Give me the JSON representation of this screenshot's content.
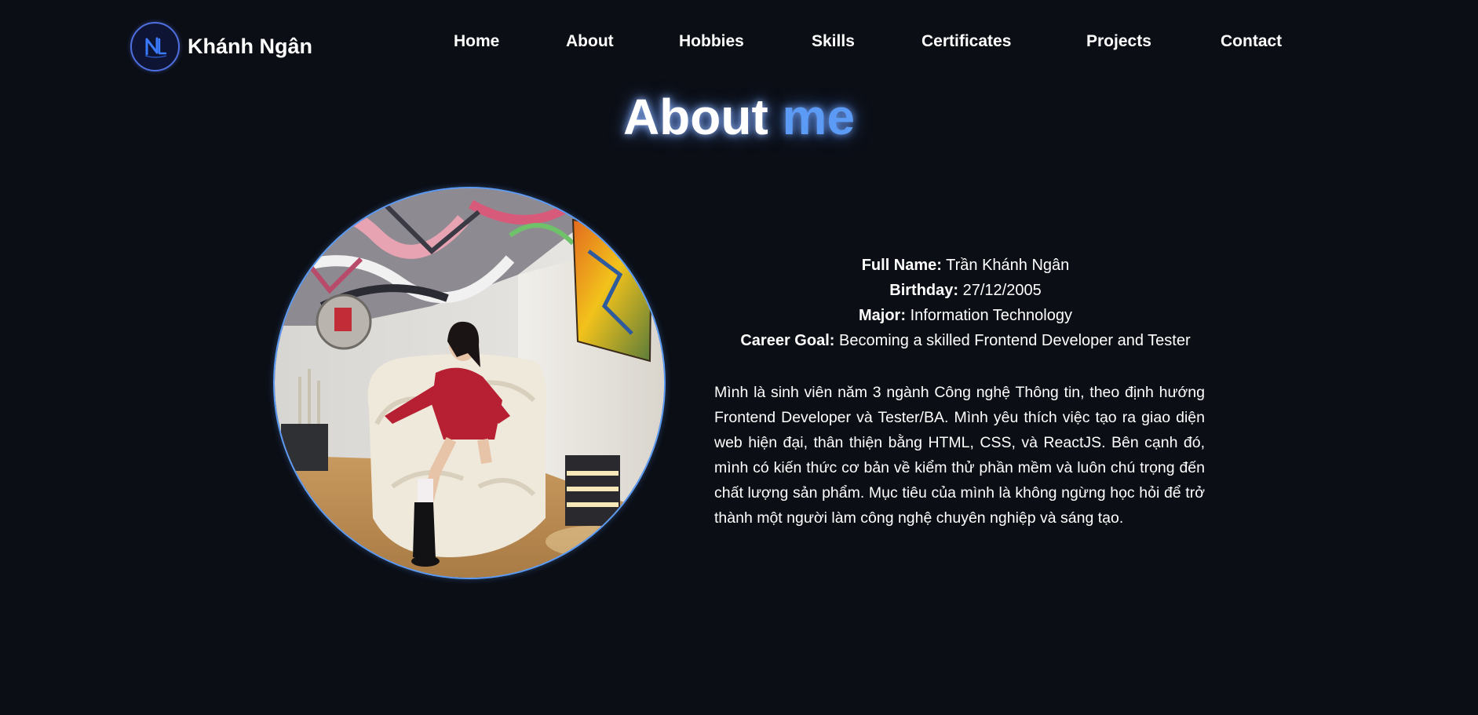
{
  "brand": {
    "name": "Khánh Ngân",
    "logo_icon": "nl-monogram-icon"
  },
  "nav": {
    "items": [
      {
        "label": "Home"
      },
      {
        "label": "About"
      },
      {
        "label": "Hobbies"
      },
      {
        "label": "Skills"
      },
      {
        "label": "Certificates"
      },
      {
        "label": "Projects"
      },
      {
        "label": "Contact"
      }
    ]
  },
  "section": {
    "title_part1": "About",
    "title_part2": "me"
  },
  "profile": {
    "full_name_label": "Full Name:",
    "full_name": "Trần Khánh Ngân",
    "birthday_label": "Birthday:",
    "birthday": "27/12/2005",
    "major_label": "Major:",
    "major": "Information Technology",
    "goal_label": "Career Goal:",
    "goal": "Becoming a skilled Frontend Developer and Tester"
  },
  "description": "Mình là sinh viên năm 3 ngành Công nghệ Thông tin, theo định hướng Frontend Developer và Tester/BA. Mình yêu thích việc tạo ra giao diện web hiện đại, thân thiện bằng HTML, CSS, và ReactJS. Bên cạnh đó, mình có kiến thức cơ bản về kiểm thử phần mềm và luôn chú trọng đến chất lượng sản phẩm. Mục tiêu của mình là không ngừng học hỏi để trở thành một người làm công nghệ chuyên nghiệp và sáng tạo.",
  "colors": {
    "background": "#0b0e15",
    "accent": "#5b9af5",
    "text": "#ffffff"
  }
}
